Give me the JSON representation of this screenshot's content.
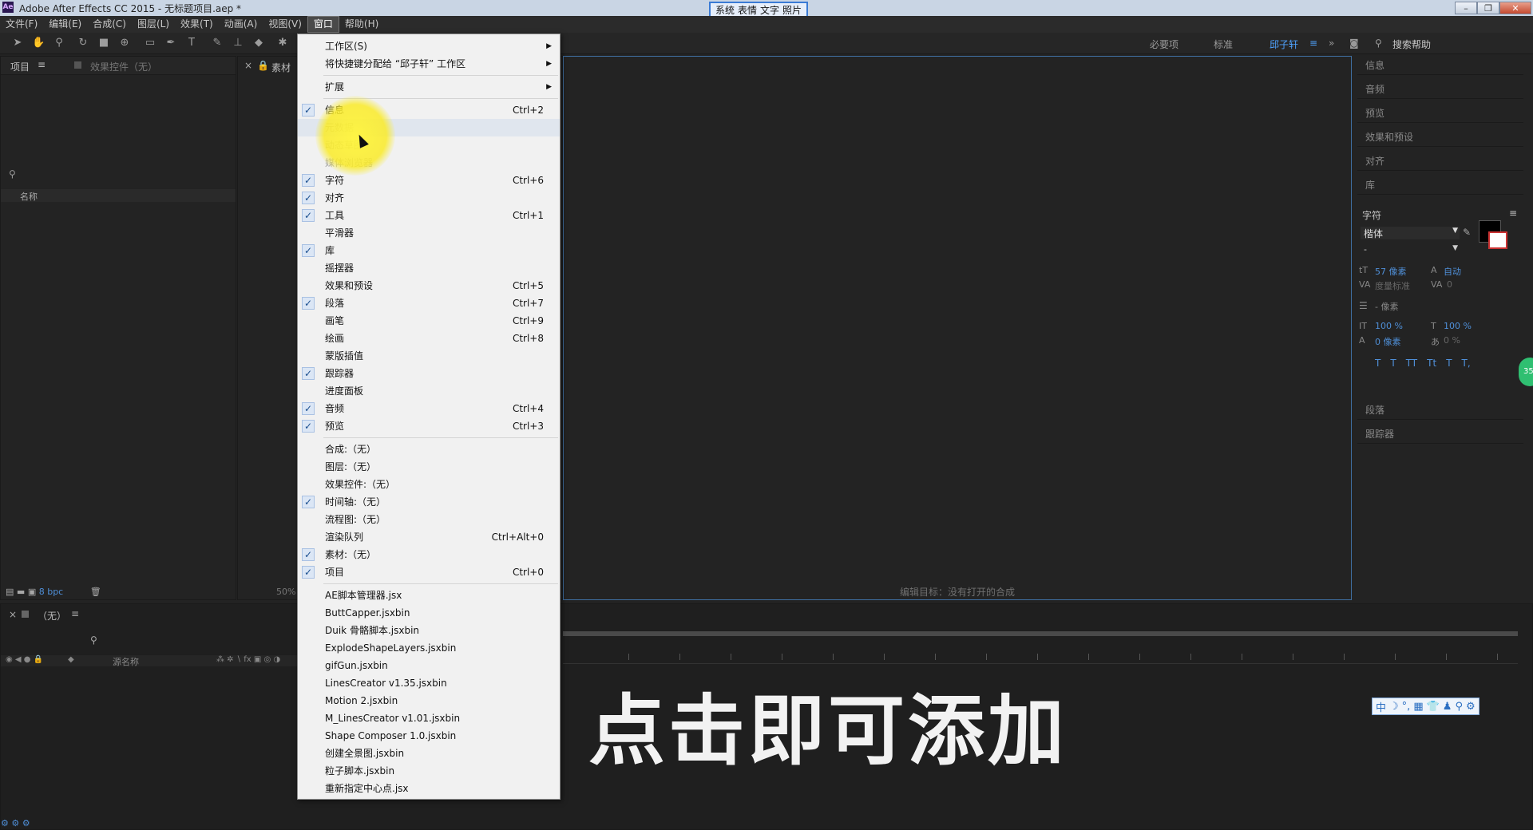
{
  "window": {
    "app_icon": "Ae",
    "title": "Adobe After Effects CC 2015 - 无标题项目.aep *",
    "ime_toolbar": [
      "系统",
      "表情",
      "文字",
      "照片"
    ],
    "controls": [
      "–",
      "❐",
      "✕"
    ]
  },
  "menubar": [
    {
      "label": "文件(F)"
    },
    {
      "label": "编辑(E)"
    },
    {
      "label": "合成(C)"
    },
    {
      "label": "图层(L)"
    },
    {
      "label": "效果(T)"
    },
    {
      "label": "动画(A)"
    },
    {
      "label": "视图(V)"
    },
    {
      "label": "窗口",
      "active": true
    },
    {
      "label": "帮助(H)"
    }
  ],
  "workspaces": {
    "items": [
      "必要项",
      "标准",
      "邱子轩"
    ],
    "active": "邱子轩",
    "more": "»",
    "search_label": "搜索帮助"
  },
  "project_panel": {
    "tab": "项目",
    "effects_tab": "效果控件（无）",
    "column_name": "名称",
    "bpc": "8 bpc"
  },
  "footage_panel": {
    "tab": "素材",
    "zoom": "50%"
  },
  "comp_status": "编辑目标：没有打开的合成",
  "timeline": {
    "tab": "（无）",
    "column_source": "源名称"
  },
  "right_panels": {
    "collapsed_top": [
      "信息",
      "音频",
      "预览",
      "效果和预设",
      "对齐",
      "库"
    ],
    "character": {
      "title": "字符",
      "font": "楷体",
      "style": "-",
      "size": "57 像素",
      "leading": "自动",
      "kerning": "度量标准",
      "tracking": "0",
      "stroke": "- 像素",
      "vscale": "100 %",
      "hscale": "100 %",
      "baseline": "0 像素",
      "tsume": "0 %",
      "style_buttons": [
        "T",
        "T",
        "TT",
        "Tt",
        "T",
        "T,"
      ]
    },
    "collapsed_bottom": [
      "段落",
      "跟踪器"
    ]
  },
  "window_menu": [
    {
      "label": "工作区(S)",
      "submenu": true
    },
    {
      "label": "将快捷键分配给 “邱子轩” 工作区",
      "submenu": true
    },
    {
      "sep": true
    },
    {
      "label": "扩展",
      "submenu": true
    },
    {
      "sep": true
    },
    {
      "label": "信息",
      "shortcut": "Ctrl+2",
      "checked": true
    },
    {
      "label": "元数据",
      "dim": true,
      "highlight": true
    },
    {
      "label": "动态草图",
      "dim": true
    },
    {
      "label": "媒体浏览器",
      "dim": true
    },
    {
      "label": "字符",
      "shortcut": "Ctrl+6",
      "checked": true
    },
    {
      "label": "对齐",
      "checked": true
    },
    {
      "label": "工具",
      "shortcut": "Ctrl+1",
      "checked": true
    },
    {
      "label": "平滑器"
    },
    {
      "label": "库",
      "checked": true
    },
    {
      "label": "摇摆器"
    },
    {
      "label": "效果和预设",
      "shortcut": "Ctrl+5"
    },
    {
      "label": "段落",
      "shortcut": "Ctrl+7",
      "checked": true
    },
    {
      "label": "画笔",
      "shortcut": "Ctrl+9"
    },
    {
      "label": "绘画",
      "shortcut": "Ctrl+8"
    },
    {
      "label": "蒙版插值"
    },
    {
      "label": "跟踪器",
      "checked": true
    },
    {
      "label": "进度面板"
    },
    {
      "label": "音频",
      "shortcut": "Ctrl+4",
      "checked": true
    },
    {
      "label": "预览",
      "shortcut": "Ctrl+3",
      "checked": true
    },
    {
      "sep": true
    },
    {
      "label": "合成:（无）"
    },
    {
      "label": "图层:（无）"
    },
    {
      "label": "效果控件:（无）"
    },
    {
      "label": "时间轴:（无）",
      "checked": true
    },
    {
      "label": "流程图:（无）"
    },
    {
      "label": "渲染队列",
      "shortcut": "Ctrl+Alt+0"
    },
    {
      "label": "素材:（无）",
      "checked": true
    },
    {
      "label": "项目",
      "shortcut": "Ctrl+0",
      "checked": true
    },
    {
      "sep": true
    },
    {
      "label": "AE脚本管理器.jsx"
    },
    {
      "label": "ButtCapper.jsxbin"
    },
    {
      "label": "Duik 骨骼脚本.jsxbin"
    },
    {
      "label": "ExplodeShapeLayers.jsxbin"
    },
    {
      "label": "gifGun.jsxbin"
    },
    {
      "label": "LinesCreator v1.35.jsxbin"
    },
    {
      "label": "Motion 2.jsxbin"
    },
    {
      "label": "M_LinesCreator v1.01.jsxbin"
    },
    {
      "label": "Shape Composer 1.0.jsxbin"
    },
    {
      "label": "创建全景图.jsxbin"
    },
    {
      "label": "粒子脚本.jsxbin"
    },
    {
      "label": "重新指定中心点.jsx"
    }
  ],
  "overlay_caption": "点击即可添加",
  "ime_bottom": [
    "中",
    "☽",
    "°,",
    "▦",
    "👕",
    "♟",
    "⚲",
    "⚙"
  ],
  "floating_badge": "35"
}
